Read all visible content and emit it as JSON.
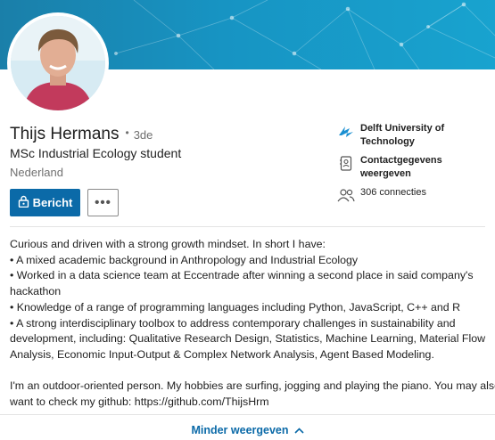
{
  "profile": {
    "name": "Thijs Hermans",
    "degree": "3de",
    "headline": "MSc Industrial Ecology student",
    "location": "Nederland"
  },
  "actions": {
    "message_label": "Bericht",
    "more_label": "•••"
  },
  "side": {
    "education": "Delft University of Technology",
    "contact": "Contactgegevens weergeven",
    "connections": "306 connecties"
  },
  "about": {
    "lines": [
      "Curious and driven with a strong growth mindset. In short I have:",
      "• A mixed academic background in Anthropology and Industrial Ecology",
      "• Worked in a data science team at Eccentrade after winning a second place in said company's",
      "hackathon",
      "• Knowledge of a range of programming languages including Python, JavaScript, C++ and R",
      "• A strong interdisciplinary toolbox to address contemporary challenges in sustainability and",
      "development, including: Qualitative Research Design, Statistics, Machine Learning, Material Flow",
      "Analysis, Economic Input-Output & Complex Network Analysis, Agent Based Modeling.",
      "",
      "I'm an outdoor-oriented person. My hobbies are surfing, jogging and playing the piano. You may also",
      "want to check my github: https://github.com/ThijsHrm"
    ]
  },
  "footer": {
    "show_less_label": "Minder weergeven"
  },
  "colors": {
    "accent": "#0b6aa8",
    "banner": "#1794c3"
  }
}
